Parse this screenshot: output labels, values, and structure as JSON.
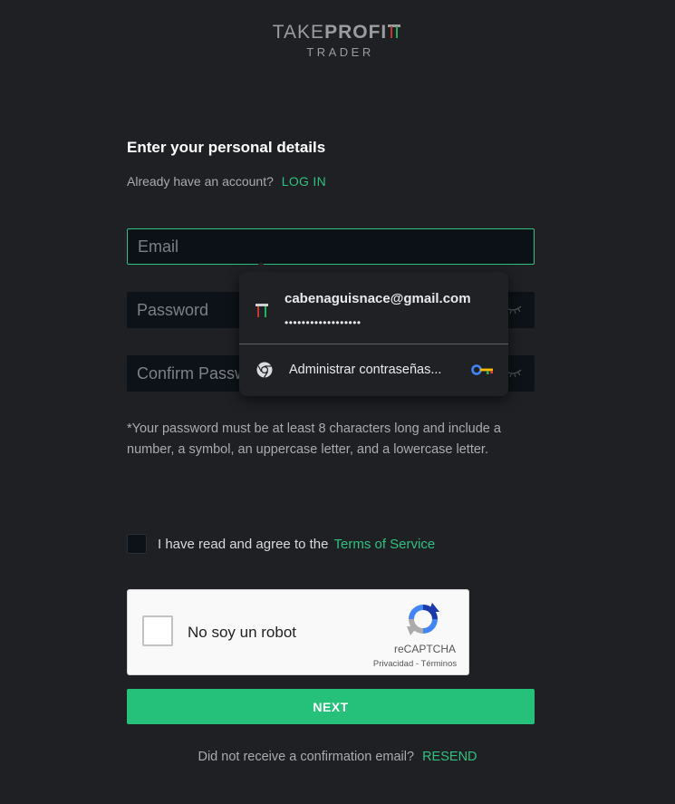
{
  "logo": {
    "take": "TAKE",
    "profit": "PROFI",
    "sub": "TRADER"
  },
  "heading": "Enter your personal details",
  "account": {
    "question": "Already have an account?",
    "login_link": "LOG IN"
  },
  "fields": {
    "email_placeholder": "Email",
    "password_placeholder": "Password",
    "confirm_placeholder": "Confirm Password"
  },
  "hint": "*Your password must be at least 8 characters long and include a number, a symbol, an uppercase letter, and a lowercase letter.",
  "agree": {
    "text": "I have read and agree to the",
    "link": "Terms of Service"
  },
  "recaptcha": {
    "label": "No soy un robot",
    "brand": "reCAPTCHA",
    "links": "Privacidad - Términos"
  },
  "next_button": "NEXT",
  "resend": {
    "question": "Did not receive a confirmation email?",
    "link": "RESEND"
  },
  "autofill_popup": {
    "username": "cabenaguisnace@gmail.com",
    "password_mask": "••••••••••••••••••",
    "manage_label": "Administrar contraseñas...",
    "icons": [
      "site-favicon-icon",
      "chrome-icon",
      "key-icon"
    ]
  },
  "colors": {
    "background": "#1e2024",
    "accent_green": "#25c07a",
    "link_green": "#2ec27e",
    "input_bg": "#0d1218",
    "popup_bg": "#202124"
  }
}
